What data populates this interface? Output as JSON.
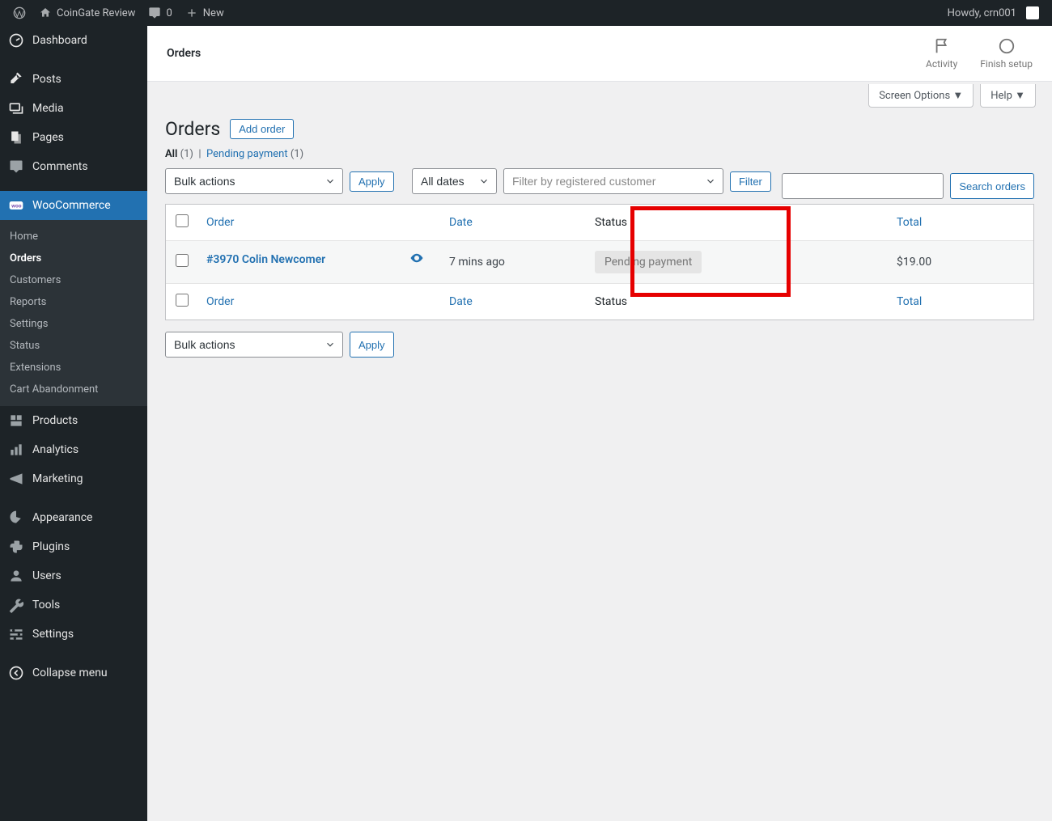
{
  "toolbar": {
    "site_name": "CoinGate Review",
    "comments": "0",
    "new": "New",
    "howdy": "Howdy, crn001"
  },
  "sidebar": {
    "dashboard": "Dashboard",
    "posts": "Posts",
    "media": "Media",
    "pages": "Pages",
    "comments": "Comments",
    "woocommerce": "WooCommerce",
    "woo_sub": {
      "home": "Home",
      "orders": "Orders",
      "customers": "Customers",
      "reports": "Reports",
      "settings": "Settings",
      "status": "Status",
      "extensions": "Extensions",
      "cart": "Cart Abandonment"
    },
    "products": "Products",
    "analytics": "Analytics",
    "marketing": "Marketing",
    "appearance": "Appearance",
    "plugins": "Plugins",
    "users": "Users",
    "tools": "Tools",
    "settings": "Settings",
    "collapse": "Collapse menu"
  },
  "heading": {
    "page": "Orders",
    "activity": "Activity",
    "finish": "Finish setup"
  },
  "tabs": {
    "screen_options": "Screen Options ▼",
    "help": "Help ▼"
  },
  "content": {
    "title": "Orders",
    "add": "Add order",
    "views": {
      "all": "All",
      "all_count": "(1)",
      "pending": "Pending payment ",
      "pending_count": "(1)"
    },
    "search": "Search orders",
    "bulk": "Bulk actions",
    "apply": "Apply",
    "dates": "All dates",
    "customer_placeholder": "Filter by registered customer",
    "filter": "Filter"
  },
  "table": {
    "cols": {
      "order": "Order",
      "date": "Date",
      "status": "Status",
      "total": "Total"
    },
    "row": {
      "order": "#3970 Colin Newcomer",
      "date": "7 mins ago",
      "status": "Pending payment",
      "total": "$19.00"
    }
  }
}
